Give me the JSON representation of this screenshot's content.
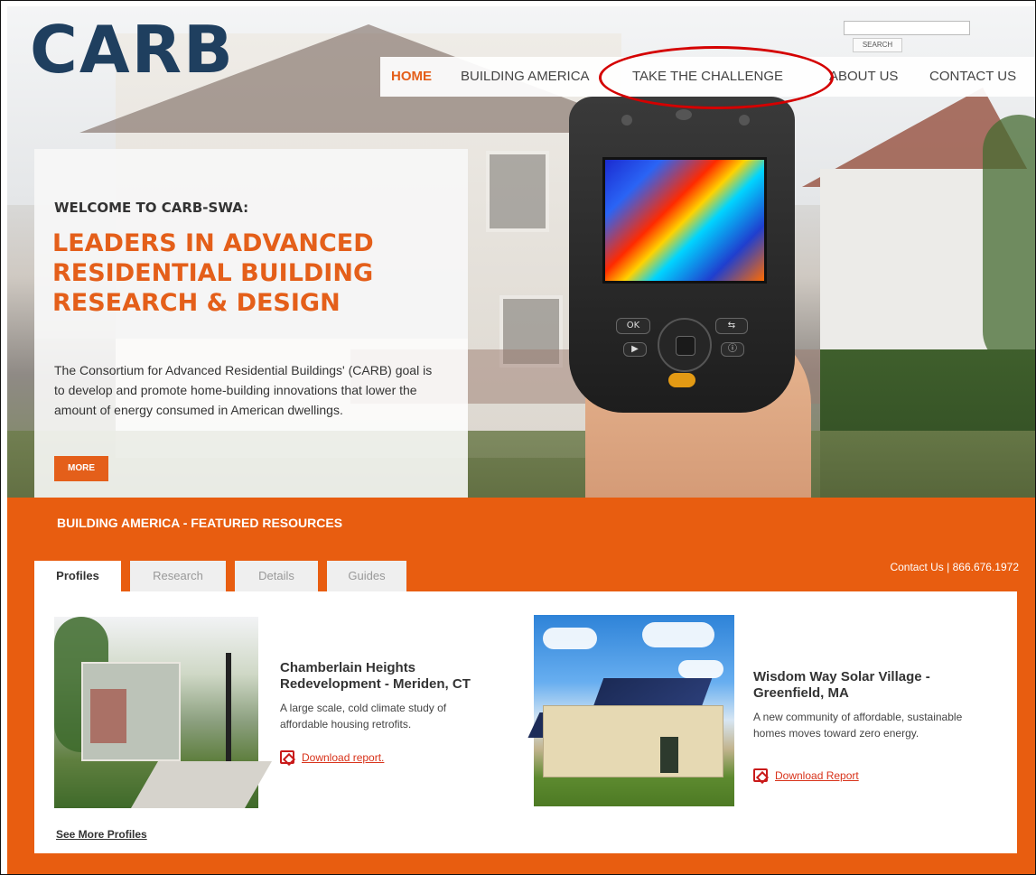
{
  "brand": {
    "logo": "CARB"
  },
  "search": {
    "button_label": "SEARCH",
    "placeholder": ""
  },
  "nav": {
    "items": [
      {
        "label": "HOME",
        "active": true
      },
      {
        "label": "BUILDING AMERICA",
        "active": false
      },
      {
        "label": "TAKE THE CHALLENGE",
        "active": false
      },
      {
        "label": "ABOUT US",
        "active": false
      },
      {
        "label": "CONTACT US",
        "active": false
      }
    ]
  },
  "welcome": {
    "heading": "WELCOME TO CARB-SWA:",
    "title": "LEADERS IN ADVANCED RESIDENTIAL BUILDING RESEARCH & DESIGN",
    "body": "The Consortium for Advanced Residential Buildings' (CARB) goal is to develop and promote home-building innovations that lower the amount of energy consumed in American dwellings.",
    "more_label": "MORE"
  },
  "camera": {
    "ok_label": "OK"
  },
  "featured": {
    "title": "BUILDING AMERICA - FEATURED RESOURCES",
    "contact": "Contact Us | 866.676.1972",
    "tabs": [
      {
        "label": "Profiles",
        "active": true
      },
      {
        "label": "Research",
        "active": false
      },
      {
        "label": "Details",
        "active": false
      },
      {
        "label": "Guides",
        "active": false
      }
    ],
    "items": [
      {
        "title": "Chamberlain Heights Redevelopment - Meriden, CT",
        "desc": "A large scale, cold climate study of affordable housing retrofits.",
        "link": "Download report."
      },
      {
        "title": "Wisdom Way Solar Village - Greenfield, MA",
        "desc": "A new community of affordable, sustainable homes moves toward zero energy.",
        "link": "Download Report"
      }
    ],
    "see_more": "See More Profiles"
  },
  "colors": {
    "accent": "#e45f1a",
    "navy": "#1f3f5f",
    "highlight": "#d40000"
  }
}
